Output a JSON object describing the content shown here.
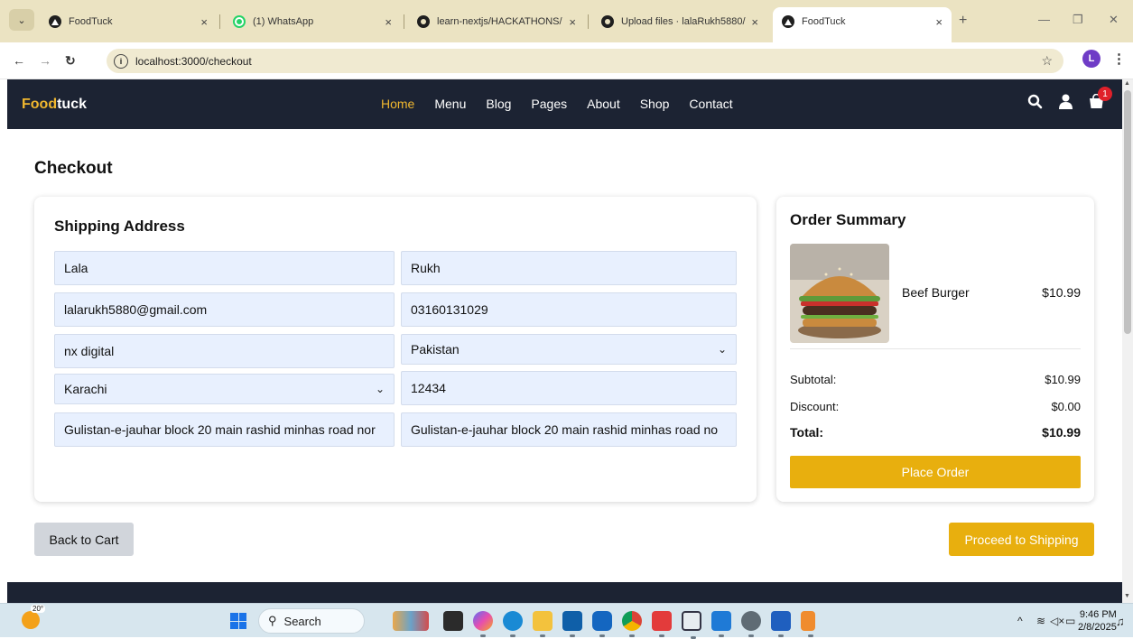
{
  "browser": {
    "tabs": [
      {
        "title": "FoodTuck",
        "icon": "app-icon"
      },
      {
        "title": "(1) WhatsApp",
        "icon": "whatsapp-icon"
      },
      {
        "title": "learn-nextjs/HACKATHONS/",
        "icon": "github-icon"
      },
      {
        "title": "Upload files · lalaRukh5880/",
        "icon": "github-icon"
      },
      {
        "title": "FoodTuck",
        "icon": "app-icon",
        "active": true
      }
    ],
    "url": "localhost:3000/checkout",
    "profile_initial": "L"
  },
  "site": {
    "brand_part1": "Food",
    "brand_part2": "tuck",
    "nav": [
      "Home",
      "Menu",
      "Blog",
      "Pages",
      "About",
      "Shop",
      "Contact"
    ],
    "active_nav": "Home",
    "cart_count": "1",
    "colors": {
      "accent": "#e8af0e",
      "header": "#1c2333",
      "field": "#e8f0fe"
    }
  },
  "checkout": {
    "title": "Checkout",
    "shipping": {
      "heading": "Shipping Address",
      "first_name": "Lala",
      "last_name": "Rukh",
      "email": "lalarukh5880@gmail.com",
      "phone": "03160131029",
      "company": "nx digital",
      "country": "Pakistan",
      "city": "Karachi",
      "zip": "12434",
      "address1": "Gulistan-e-jauhar block 20 main rashid minhas road nor",
      "address2": "Gulistan-e-jauhar block 20 main rashid minhas road no"
    },
    "summary": {
      "heading": "Order Summary",
      "item_name": "Beef Burger",
      "item_price": "$10.99",
      "subtotal_label": "Subtotal:",
      "subtotal": "$10.99",
      "discount_label": "Discount:",
      "discount": "$0.00",
      "total_label": "Total:",
      "total": "$10.99",
      "place_order": "Place Order"
    },
    "back_label": "Back to Cart",
    "proceed_label": "Proceed to Shipping"
  },
  "taskbar": {
    "temperature": "20°",
    "search": "Search",
    "time": "9:46 PM",
    "date": "2/8/2025"
  }
}
